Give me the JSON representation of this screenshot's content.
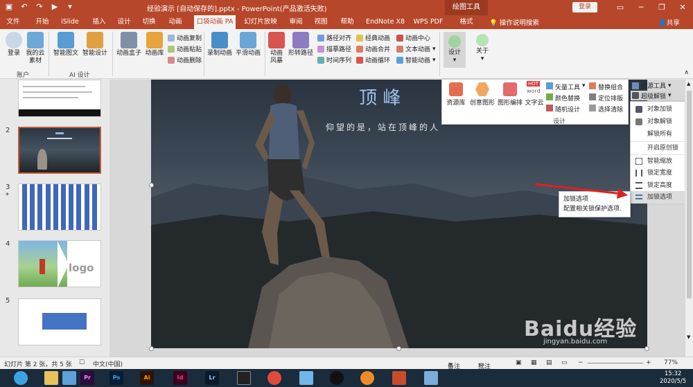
{
  "window": {
    "title": "经验演示 [自动保存的].pptx - PowerPoint(产品激活失败)",
    "context_tab": "绘图工具",
    "login_label": "登录",
    "tell_me": "操作说明搜索",
    "share": "共享"
  },
  "tabs": [
    "文件",
    "开始",
    "iSlide",
    "插入",
    "设计",
    "切换",
    "动画",
    "口袋动画 PA",
    "幻灯片放映",
    "审阅",
    "视图",
    "帮助",
    "EndNote X8",
    "WPS PDF",
    "格式"
  ],
  "ribbon": {
    "big": [
      "登录",
      "我的云素材",
      "智能图文",
      "智能设计",
      "动画盒子",
      "动画库",
      "录制动画",
      "平滑动画",
      "动画风暴",
      "形转路径",
      "设计",
      "关于"
    ],
    "small_a": [
      "动画复制",
      "动画粘贴",
      "动画删除"
    ],
    "small_b": [
      "路径对齐",
      "描摹路径",
      "时间序列"
    ],
    "small_c": [
      "经典动画",
      "动画合并",
      "动画循环"
    ],
    "small_d": [
      "动画中心",
      "文本动画",
      "智能动画"
    ],
    "groups": [
      "账户",
      "AI 设计"
    ]
  },
  "design_panel": {
    "big": [
      "资源库",
      "创意图形",
      "图形编排",
      "文字云"
    ],
    "small_a": [
      "矢量工具",
      "颜色替换",
      "随机设计"
    ],
    "small_b": [
      "替换组合",
      "定位排版",
      "选择清除"
    ],
    "small_c": [
      "资源工具",
      "超级解锁"
    ],
    "group_label": "设计",
    "hot_badge": "HOT",
    "word_badge": "word"
  },
  "dropdown": {
    "items": [
      "对象加锁",
      "对象解锁",
      "解锁所有",
      "开启原创锁",
      "智能缩放",
      "锁定宽度",
      "锁定高度",
      "加锁选项"
    ]
  },
  "tooltip": {
    "title": "加锁选项",
    "desc": "配置相关锁保护选项."
  },
  "slide": {
    "title": "顶 峰",
    "subtitle": "仰望的是，站在顶峰的人"
  },
  "thumbnails": {
    "numbers": [
      "2",
      "3",
      "4",
      "5"
    ],
    "star": "*",
    "logo_text": "logo"
  },
  "statusbar": {
    "slide_info": "幻灯片 第 2 张，共 5 张",
    "language": "中文(中国)",
    "notes": "备注",
    "comments": "批注",
    "zoom": "77%"
  },
  "taskbar": {
    "apps": [
      "Pr",
      "Ps",
      "Ai",
      "Id",
      "Lr"
    ],
    "time": "15:32",
    "date": "2020/5/5"
  },
  "watermark": {
    "text": "Baidu经验",
    "sub": "jingyan.baidu.com"
  },
  "colors": {
    "accent": "#b7472a",
    "highlight": "#c55a3a"
  }
}
